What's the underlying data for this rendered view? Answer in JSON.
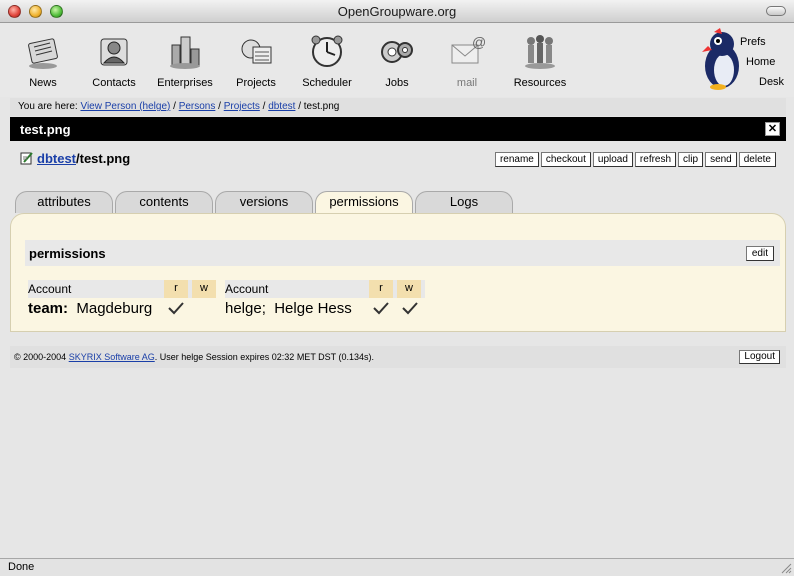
{
  "window": {
    "title": "OpenGroupware.org"
  },
  "toolbar": {
    "items": [
      {
        "label": "News",
        "icon": "news-icon"
      },
      {
        "label": "Contacts",
        "icon": "contacts-icon"
      },
      {
        "label": "Enterprises",
        "icon": "enterprises-icon"
      },
      {
        "label": "Projects",
        "icon": "projects-icon"
      },
      {
        "label": "Scheduler",
        "icon": "scheduler-icon"
      },
      {
        "label": "Jobs",
        "icon": "jobs-icon"
      },
      {
        "label": "mail",
        "icon": "mail-icon"
      },
      {
        "label": "Resources",
        "icon": "resources-icon"
      }
    ],
    "right_links": {
      "prefs": "Prefs",
      "home": "Home",
      "desk": "Desk"
    }
  },
  "breadcrumb": {
    "prefix": "You are here:",
    "items": [
      "View Person (helge)",
      "Persons",
      "Projects",
      "dbtest"
    ],
    "current": "test.png",
    "separator": "/"
  },
  "document": {
    "title": "test.png",
    "close": "✕",
    "folder_link": "dbtest",
    "file_name": "/test.png",
    "actions": [
      "rename",
      "checkout",
      "upload",
      "refresh",
      "clip",
      "send",
      "delete"
    ]
  },
  "tabs": [
    "attributes",
    "contents",
    "versions",
    "permissions",
    "Logs"
  ],
  "active_tab": "permissions",
  "permissions": {
    "title": "permissions",
    "edit_label": "edit",
    "tables": [
      {
        "header": "Account",
        "r": "r",
        "w": "w",
        "entry_prefix": "team:",
        "entry_name": "Magdeburg",
        "read": true,
        "write": false
      },
      {
        "header": "Account",
        "r": "r",
        "w": "w",
        "entry_prefix": "helge;",
        "entry_name": "Helge  Hess",
        "read": true,
        "write": true
      }
    ]
  },
  "footer": {
    "copyright": "© 2000-2004",
    "company": "SKYRIX Software AG",
    "session": ". User helge Session expires 02:32 MET DST (0.134s).",
    "logout_label": "Logout"
  },
  "status": {
    "text": "Done"
  },
  "colors": {
    "link": "#1a3fa8",
    "panel": "#fbf6e2",
    "rw_header": "#f3dfae",
    "title_strip": "#000000"
  }
}
